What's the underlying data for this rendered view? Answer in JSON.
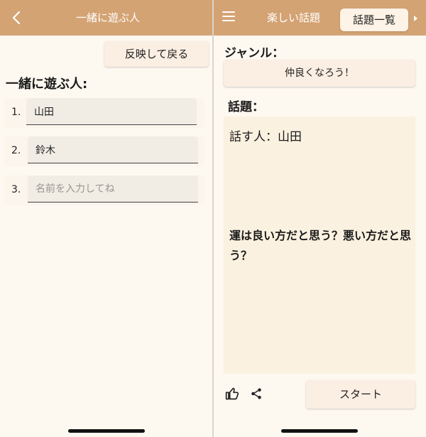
{
  "left_screen": {
    "header": {
      "title": "一緒に遊ぶ人",
      "back_icon": "chevron-left-icon"
    },
    "reflect_back_label": "反映して戻る",
    "section_title": "一緒に遊ぶ人:",
    "players": [
      {
        "number": "1.",
        "value": "山田",
        "placeholder": "名前を入力してね"
      },
      {
        "number": "2.",
        "value": "鈴木",
        "placeholder": "名前を入力してね"
      },
      {
        "number": "3.",
        "value": "",
        "placeholder": "名前を入力してね"
      }
    ]
  },
  "right_screen": {
    "header": {
      "title": "楽しい話題",
      "menu_icon": "hamburger-menu-icon",
      "topic_list_label": "話題一覧",
      "more_icon": "triangle-right-icon"
    },
    "genre_label": "ジャンル：",
    "genre_value": "仲良くなろう！",
    "topic_label": "話題：",
    "speaker_text": "話す人：山田",
    "question_text": "運は良い方だと思う？悪い方だと思う？",
    "start_label": "スタート",
    "like_icon": "thumbs-up-icon",
    "share_icon": "share-icon"
  },
  "colors": {
    "header": "#d4a373",
    "background": "#fdf8f0",
    "button": "#fbeee2",
    "card": "#fbf1e0"
  }
}
